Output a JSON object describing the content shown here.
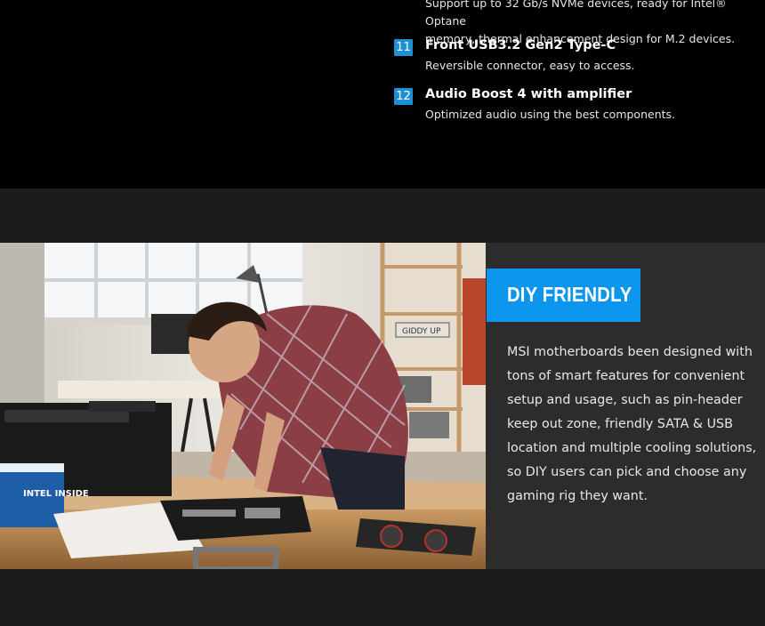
{
  "features": {
    "partial_lines": [
      "Support up to 32 Gb/s NVMe devices, ready for Intel® Optane",
      "memory, thermal enhancement design for M.2 devices."
    ],
    "items": [
      {
        "number": "11",
        "title": "Front USB3.2 Gen2 Type-C",
        "desc": "Reversible connector, easy to access."
      },
      {
        "number": "12",
        "title": "Audio Boost 4 with amplifier",
        "desc": "Optimized audio using the best components."
      }
    ]
  },
  "diy": {
    "heading": "DIY FRIENDLY",
    "lines": [
      "MSI motherboards been designed with",
      "tons of smart features for convenient",
      "setup and usage, such as pin-header",
      "keep out zone, friendly SATA & USB",
      "location and multiple cooling solutions,",
      "so DIY users can pick and choose any",
      "gaming rig they want."
    ],
    "image": {
      "intel_box_label": "INTEL INSIDE",
      "poster_text": "GIDDY UP"
    }
  },
  "colors": {
    "accent": "#0b95ec",
    "number_badge": "#1e90d6",
    "panel": "#2c2c2c",
    "page": "#1c1c1c",
    "top": "#000000"
  }
}
